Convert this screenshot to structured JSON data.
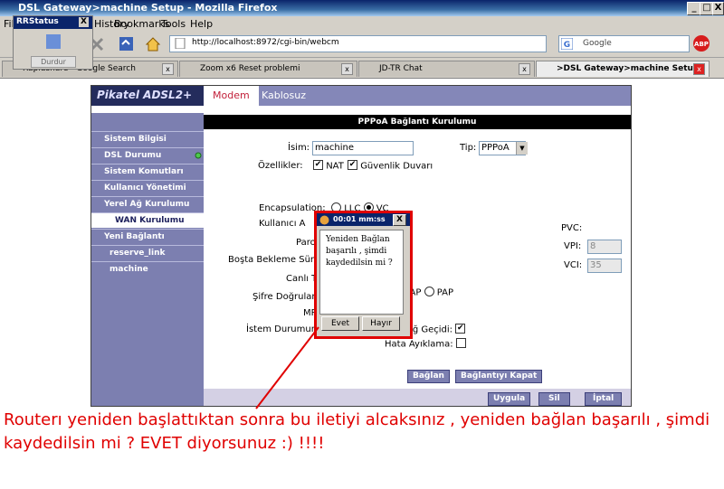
{
  "window": {
    "title": "DSL Gateway>machine Setup - Mozilla Firefox",
    "controls": [
      "_",
      "□",
      "X"
    ]
  },
  "menu": {
    "items": [
      "File",
      "History",
      "Bookmarks",
      "Tools",
      "Help"
    ]
  },
  "rrstatus": {
    "title": "RRStatus",
    "close": "X",
    "button": "Durdur"
  },
  "nav": {
    "url": "http://localhost:8972/cgi-bin/webcm",
    "search_placeholder": "Google"
  },
  "tabs": [
    {
      "label": "Rapidshare - Google Search",
      "active": false
    },
    {
      "label": "Zoom x6 Reset problemi",
      "active": false
    },
    {
      "label": "JD-TR Chat",
      "active": false
    },
    {
      "label": ">DSL Gateway>machine Setup",
      "active": true
    }
  ],
  "router": {
    "brand": "Pikatel ADSL2+",
    "top_tabs": [
      "Modem",
      "Kablosuz"
    ],
    "sidebar": [
      {
        "label": "Sistem Bilgisi"
      },
      {
        "label": "DSL Durumu"
      },
      {
        "label": "Sistem Komutları"
      },
      {
        "label": "Kullanıcı Yönetimi"
      },
      {
        "label": "Yerel Ağ Kurulumu"
      },
      {
        "label": "WAN Kurulumu"
      },
      {
        "label": "Yeni Bağlantı"
      },
      {
        "label": "reserve_link"
      },
      {
        "label": "machine"
      }
    ],
    "section_title": "PPPoA Bağlantı Kurulumu",
    "form": {
      "name_label": "İsim:",
      "name_value": "machine",
      "type_label": "Tip:",
      "type_value": "PPPoA",
      "features_label": "Özellikler:",
      "nat_label": "NAT",
      "firewall_label": "Güvenlik Duvarı",
      "encapsulation_label": "Encapsulation:",
      "llc_label": "LLC",
      "vc_label": "VC",
      "user_label": "Kullanıcı A",
      "password_label": "Paro",
      "idle_label": "Boşta Bekleme Süre",
      "keepalive_label": "Canlı T",
      "auth_label": "Şifre Doğrulam",
      "chap_label": "HAP",
      "pap_label": "PAP",
      "mru_label": "MR",
      "ondemand_label": "İstem Durumund",
      "gateway_label": "Ağ Geçidi:",
      "debug_label": "Hata Ayıklama:",
      "pvc_label": "PVC:",
      "vpi_label": "VPI:",
      "vpi_value": "8",
      "vci_label": "VCI:",
      "vci_value": "35"
    },
    "buttons": {
      "connect": "Bağlan",
      "disconnect": "Bağlantıyı Kapat",
      "apply": "Uygula",
      "delete": "Sil",
      "cancel": "İptal"
    }
  },
  "dialog": {
    "title": "00:01 mm:ss",
    "close": "X",
    "message": "Yeniden Bağlan başarılı , şimdi kaydedilsin mi ?",
    "yes": "Evet",
    "no": "Hayır"
  },
  "annotation": {
    "text": "Routerı yeniden başlattıktan sonra bu iletiyi alcaksınız , yeniden bağlan başarılı , şimdi kaydedilsin mi ? EVET diyorsunuz :) !!!!",
    "color": "#e00000"
  }
}
